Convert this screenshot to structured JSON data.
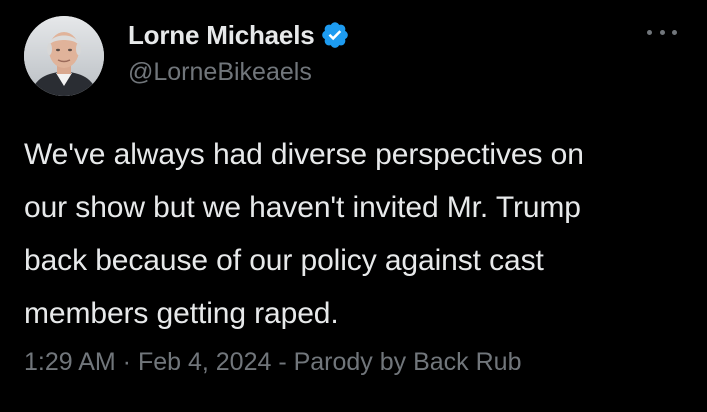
{
  "author": {
    "display_name": "Lorne Michaels",
    "handle": "@LorneBikeaels",
    "verified": true,
    "verified_badge_color": "#1d9bf0",
    "avatar_icon": "profile-photo"
  },
  "tweet": {
    "text": "We've always had diverse perspectives on\nour show but we haven't invited Mr. Trump\nback because of our policy against cast\nmembers getting raped.",
    "meta": "1:29 AM · Feb 4, 2024 - Parody by Back Rub"
  },
  "colors": {
    "background": "#000000",
    "primary_text": "#e7e9ea",
    "secondary_text": "#71767b"
  },
  "icons": {
    "more": "more-options-icon",
    "verified": "verified-badge-icon"
  }
}
